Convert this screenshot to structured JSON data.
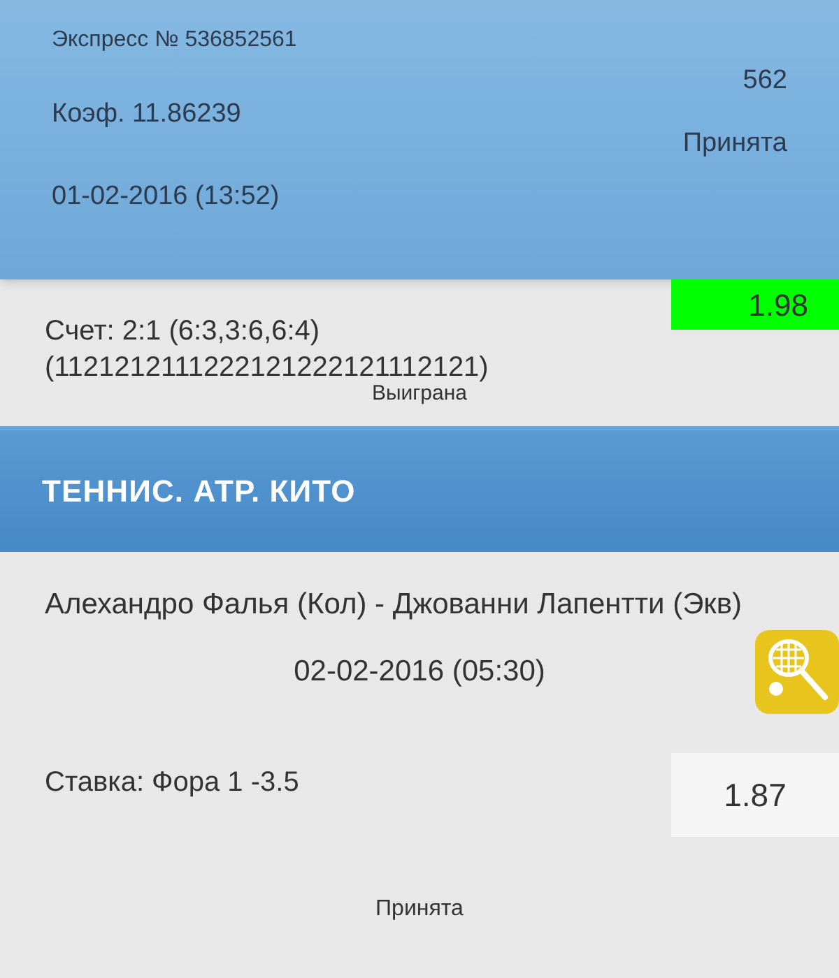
{
  "header": {
    "express": "Экспресс № 536852561",
    "coef": "Коэф. 11.86239",
    "date": "01-02-2016 (13:52)",
    "amount": "562",
    "status": "Принята"
  },
  "sections": [
    {
      "kind": "bet",
      "won": true,
      "odds": "1.98",
      "score": "Счет: 2:1 (6:3,3:6,6:4) (1121212111222121222121112121)",
      "status": "Выиграна"
    },
    {
      "kind": "title",
      "title": "ТЕННИС. АТР. КИТО"
    },
    {
      "kind": "match",
      "won": false,
      "players": "Алехандро Фалья (Кол) - Джованни Лапентти (Экв)",
      "date": "02-02-2016 (05:30)",
      "stake": "Ставка: Фора 1 -3.5",
      "odds": "1.87",
      "status": "Принята"
    }
  ]
}
